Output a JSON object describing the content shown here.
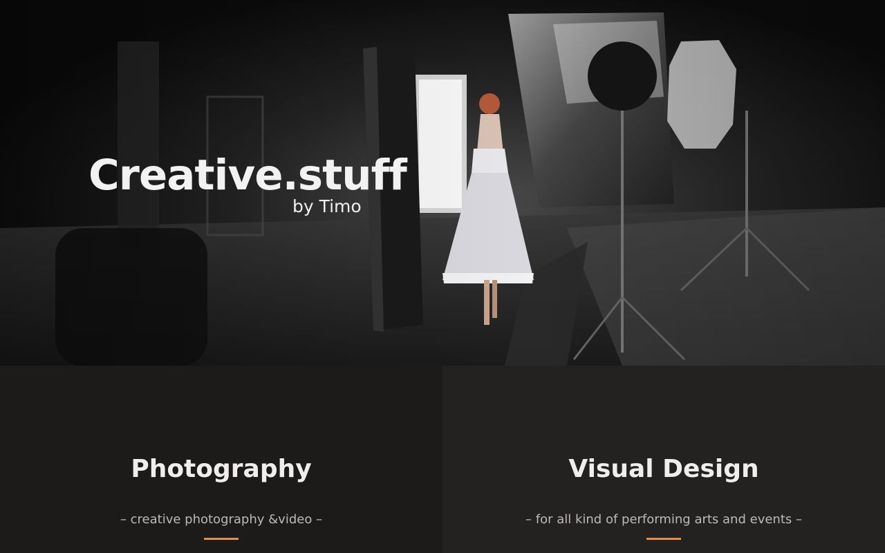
{
  "hero": {
    "title": "Creative.stuff",
    "subtitle": "by Timo",
    "image_icon": "photo-studio-ballerina"
  },
  "services": [
    {
      "title": "Photography",
      "tagline": "– creative photography &video –"
    },
    {
      "title": "Visual Design",
      "tagline": "– for all kind of performing arts and events –"
    }
  ],
  "colors": {
    "accent": "#e0924a",
    "panel_left": "#1c1b1a",
    "panel_right": "#232220",
    "heading": "#f0eeec",
    "tagline": "#bdbab6"
  }
}
